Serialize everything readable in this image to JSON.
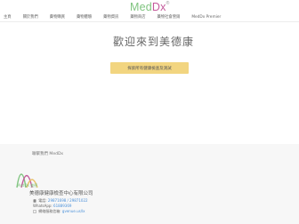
{
  "brand": {
    "logo_main": "Med",
    "logo_accent": "Dx",
    "logo_reg": "®",
    "accent_green": "#7fc47f",
    "accent_pink": "#c45a9b"
  },
  "nav": {
    "items": [
      "主頁",
      "關於我們",
      "藥物購買",
      "藥物體驗",
      "藥物資訊",
      "藥物商店",
      "藥物社會營銷",
      "MedDx Premier"
    ]
  },
  "hero": {
    "title": "歡迎來到美德康",
    "button_label": "探索所有健康檢查及測試",
    "button_color": "#f2d580"
  },
  "footer": {
    "heading": "聯繫我們 MedDx",
    "brand_caption": "MedDx 美德",
    "company": "美德康健康檢查中心有限公司",
    "phone_label": "電話:",
    "phone_value": "29871698 / 29871022",
    "whatsapp_label": "WhatsApp:",
    "whatsapp_value": "61889369",
    "email_label": "網絡服務信箱:",
    "email_value": "gvenue.us/lx"
  },
  "icons": [
    "phone-icon",
    "whatsapp-icon",
    "email-icon",
    "location-icon"
  ]
}
